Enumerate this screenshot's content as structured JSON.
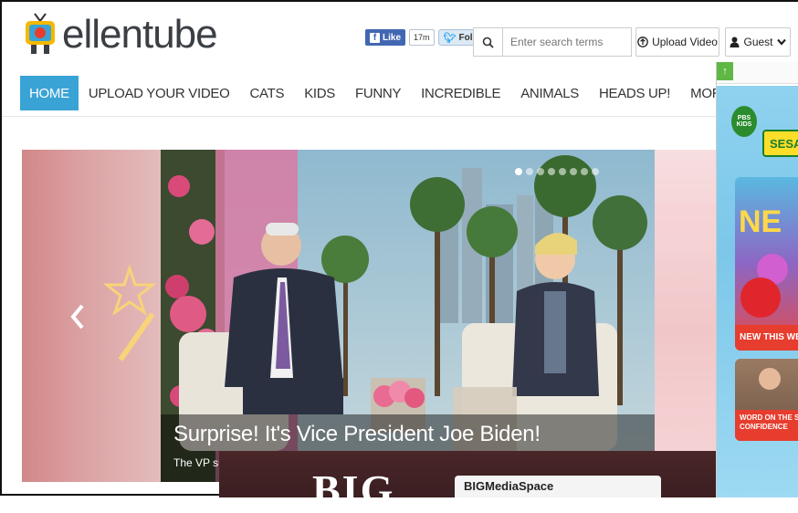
{
  "brand": {
    "name": "ellentube"
  },
  "social": {
    "fb_like": "Like",
    "fb_count": "17m",
    "tw_follow": "Follow"
  },
  "search": {
    "placeholder": "Enter search terms"
  },
  "actions": {
    "upload": "Upload Video",
    "guest": "Guest"
  },
  "nav": {
    "items": [
      {
        "label": "HOME",
        "active": true
      },
      {
        "label": "UPLOAD YOUR VIDEO"
      },
      {
        "label": "CATS"
      },
      {
        "label": "KIDS"
      },
      {
        "label": "FUNNY"
      },
      {
        "label": "INCREDIBLE"
      },
      {
        "label": "ANIMALS"
      },
      {
        "label": "HEADS UP!"
      },
      {
        "label": "MORE CATEGO"
      }
    ]
  },
  "hero": {
    "title": "Surprise! It's Vice President Joe Biden!",
    "subtitle": "The VP su",
    "slide_count": 8,
    "active_slide": 0
  },
  "bottom_ad": {
    "big": "BIG",
    "card_title": "BIGMediaSpace"
  },
  "side_ad": {
    "pbs": "PBS KIDS",
    "sesame": "SESAM",
    "card1_big": "NE",
    "card1_label": "NEW THIS WE",
    "card2_label": "WORD ON THE S CONFIDENCE"
  },
  "colors": {
    "nav_active": "#3aa3d6",
    "fb": "#4267b2",
    "ad_red": "#e63d2e"
  }
}
